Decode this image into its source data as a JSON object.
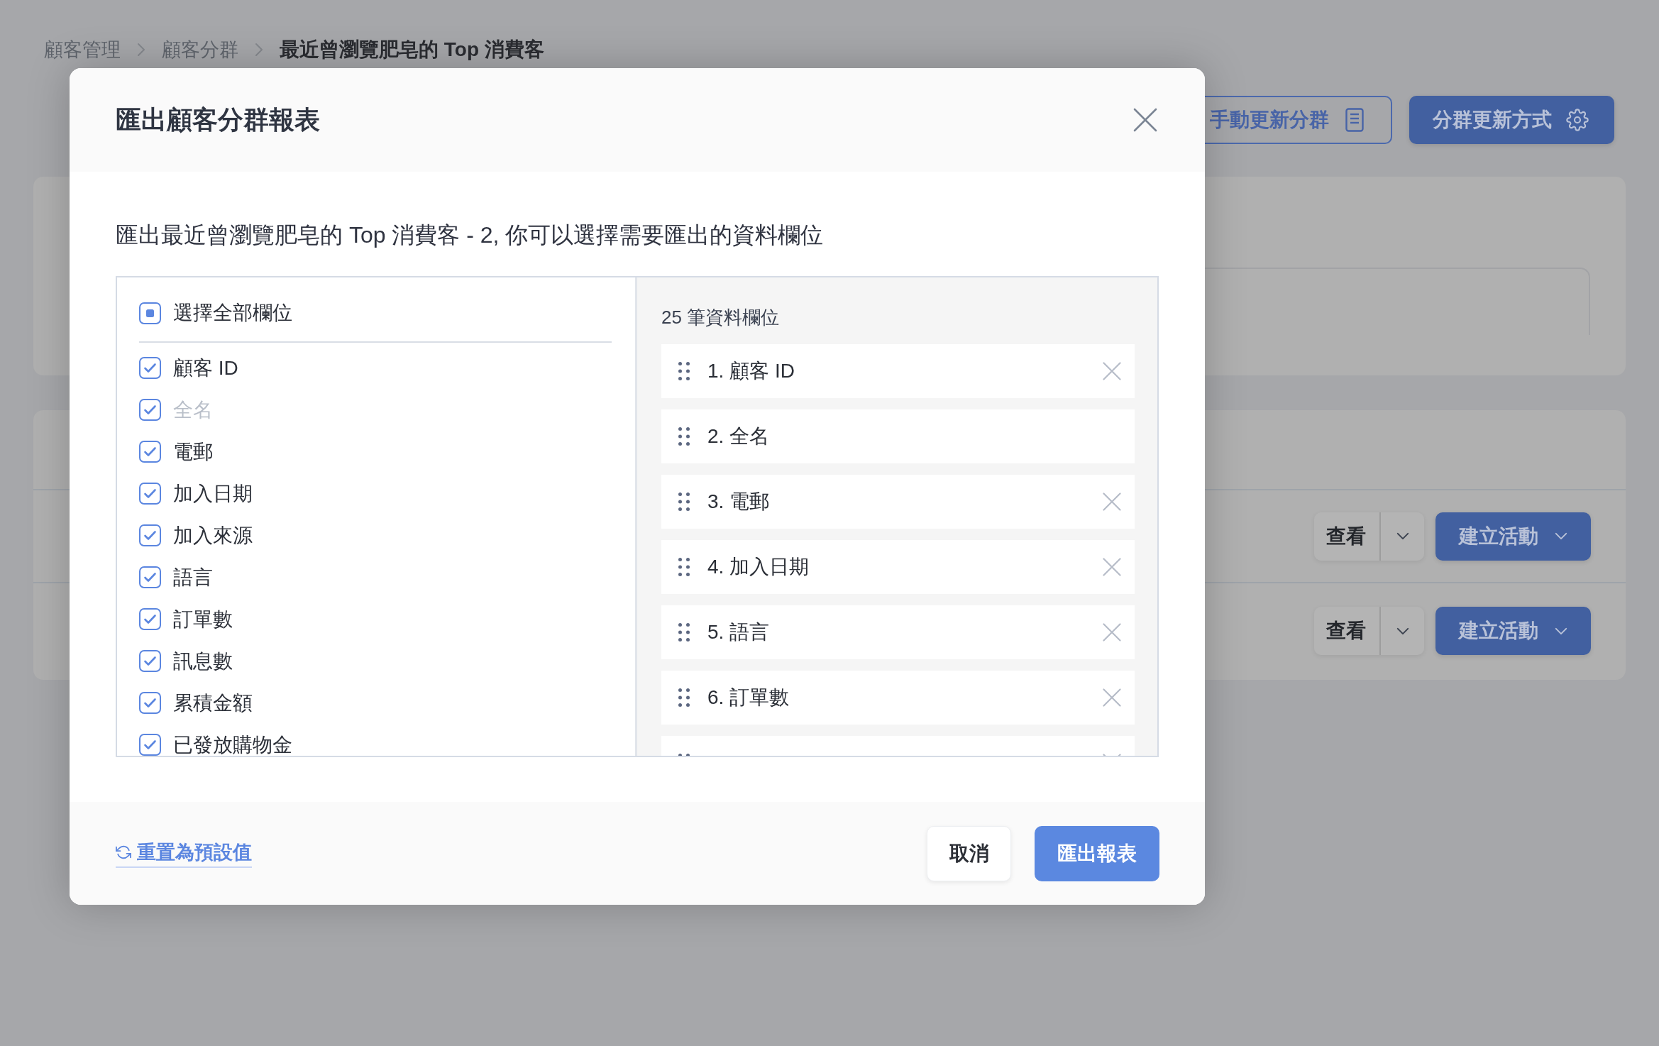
{
  "breadcrumb": [
    {
      "label": "顧客管理",
      "current": false
    },
    {
      "label": "顧客分群",
      "current": false
    },
    {
      "label": "最近曾瀏覽肥皂的 Top 消費客",
      "current": true
    }
  ],
  "header_buttons": [
    {
      "label": "手動更新分群",
      "kind": "outline"
    },
    {
      "label": "分群更新方式",
      "kind": "primary"
    }
  ],
  "segment_rows": [
    {
      "view_button": "查看",
      "action_button": "建立活動"
    },
    {
      "view_button": "查看",
      "action_button": "建立活動"
    }
  ],
  "dialog": {
    "title": "匯出顧客分群報表",
    "description": "匯出最近曾瀏覽肥皂的 Top 消費客 - 2, 你可以選擇需要匯出的資料欄位",
    "select_all": {
      "label": "選擇全部欄位",
      "checked": false,
      "indeterminate": true
    },
    "fields": [
      {
        "label": "顧客 ID",
        "checked": true,
        "disabled": false
      },
      {
        "label": "全名",
        "checked": true,
        "disabled": true
      },
      {
        "label": "電郵",
        "checked": true,
        "disabled": false
      },
      {
        "label": "加入日期",
        "checked": true,
        "disabled": false
      },
      {
        "label": "加入來源",
        "checked": true,
        "disabled": false
      },
      {
        "label": "語言",
        "checked": true,
        "disabled": false
      },
      {
        "label": "訂單數",
        "checked": true,
        "disabled": false
      },
      {
        "label": "訊息數",
        "checked": true,
        "disabled": false
      },
      {
        "label": "累積金額",
        "checked": true,
        "disabled": false
      },
      {
        "label": "已發放購物金",
        "checked": true,
        "disabled": false
      }
    ],
    "selected_count": "25 筆資料欄位",
    "selected_fields": [
      {
        "label": "1. 顧客 ID",
        "removable": true
      },
      {
        "label": "2. 全名",
        "removable": false
      },
      {
        "label": "3. 電郵",
        "removable": true
      },
      {
        "label": "4. 加入日期",
        "removable": true
      },
      {
        "label": "5. 語言",
        "removable": true
      },
      {
        "label": "6. 訂單數",
        "removable": true
      },
      {
        "removable": true
      }
    ],
    "reset_link": "重置為預設值",
    "buttons": [
      {
        "label": "取消",
        "kind": "secondary"
      },
      {
        "label": "匯出報表",
        "kind": "primary"
      }
    ]
  }
}
